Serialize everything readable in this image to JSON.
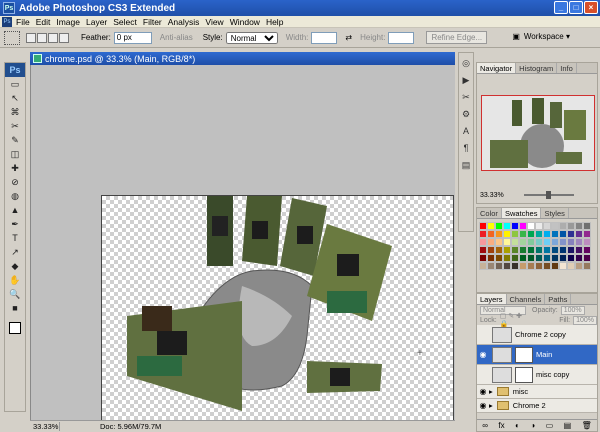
{
  "window": {
    "title": "Adobe Photoshop CS3 Extended",
    "controls": [
      "_",
      "□",
      "×"
    ]
  },
  "menu": [
    "File",
    "Edit",
    "Image",
    "Layer",
    "Select",
    "Filter",
    "Analysis",
    "View",
    "Window",
    "Help"
  ],
  "options": {
    "feather_label": "Feather:",
    "feather_value": "0 px",
    "antialias_label": "Anti-alias",
    "style_label": "Style:",
    "style_value": "Normal",
    "width_label": "Width:",
    "height_label": "Height:",
    "refine_label": "Refine Edge...",
    "workspace_label": "Workspace ▾"
  },
  "document": {
    "title": "chrome.psd @ 33.3% (Main, RGB/8*)",
    "zoom": "33.33%",
    "doc_info": "Doc: 5.96M/79.7M"
  },
  "navigator": {
    "tabs": [
      "Navigator",
      "Histogram",
      "Info"
    ],
    "zoom": "33.33%"
  },
  "swatches": {
    "tabs": [
      "Color",
      "Swatches",
      "Styles"
    ],
    "colors": [
      "#ff0000",
      "#ffff00",
      "#00ff00",
      "#00ffff",
      "#0000ff",
      "#ff00ff",
      "#ffffff",
      "#ebebeb",
      "#d6d6d6",
      "#c2c2c2",
      "#adadad",
      "#999999",
      "#858585",
      "#707070",
      "#ed1c24",
      "#f26522",
      "#f7941d",
      "#fff200",
      "#8dc63f",
      "#39b54a",
      "#00a651",
      "#00a99d",
      "#00aeef",
      "#0072bc",
      "#0054a6",
      "#2e3192",
      "#662d91",
      "#92278f",
      "#f6989d",
      "#f9ad81",
      "#fdc689",
      "#fff799",
      "#c4df9b",
      "#a3d39c",
      "#82ca9c",
      "#7accc8",
      "#6dcff6",
      "#7da7d9",
      "#8393ca",
      "#8781bd",
      "#a186be",
      "#bd8cbf",
      "#9e0b0f",
      "#a0410d",
      "#a36209",
      "#aba000",
      "#598527",
      "#197b30",
      "#007236",
      "#00746b",
      "#0076a3",
      "#004a80",
      "#003471",
      "#1b1464",
      "#440e62",
      "#630460",
      "#790000",
      "#7b2e00",
      "#7d4900",
      "#827b00",
      "#406618",
      "#005e20",
      "#005826",
      "#005952",
      "#005b7f",
      "#003663",
      "#002157",
      "#0d004c",
      "#32004b",
      "#4b0049",
      "#c7b299",
      "#998675",
      "#736357",
      "#534741",
      "#37302a",
      "#c69c6d",
      "#a67c52",
      "#8c6239",
      "#754c24",
      "#603913",
      "#f4e5d3",
      "#e0cdb6",
      "#b89d82",
      "#95795f"
    ]
  },
  "layers": {
    "tabs": [
      "Layers",
      "Channels",
      "Paths"
    ],
    "blend_mode": "Normal",
    "opacity_label": "Opacity:",
    "opacity_value": "100%",
    "lock_label": "Lock:",
    "fill_label": "Fill:",
    "fill_value": "100%",
    "items": [
      {
        "name": "Chrome 2 copy",
        "selected": false,
        "visible": false,
        "type": "layer"
      },
      {
        "name": "Main",
        "selected": true,
        "visible": true,
        "type": "layer"
      },
      {
        "name": "misc copy",
        "selected": false,
        "visible": false,
        "type": "layer"
      },
      {
        "name": "misc",
        "selected": false,
        "visible": true,
        "type": "group"
      },
      {
        "name": "Chrome 2",
        "selected": false,
        "visible": true,
        "type": "group"
      }
    ],
    "bottom_icons": [
      "∞",
      "fx",
      "◐",
      "◑",
      "▭",
      "▤",
      "🗑"
    ]
  },
  "tools": [
    "▭",
    "↖",
    "⌘",
    "✂",
    "✎",
    "◫",
    "✚",
    "⊘",
    "◍",
    "▲",
    "✒",
    "T",
    "↗",
    "◆",
    "✋",
    "🔍",
    "■"
  ],
  "dock_icons": [
    "◎",
    "▶",
    "✂",
    "⚙",
    "A",
    "¶",
    "▤"
  ]
}
